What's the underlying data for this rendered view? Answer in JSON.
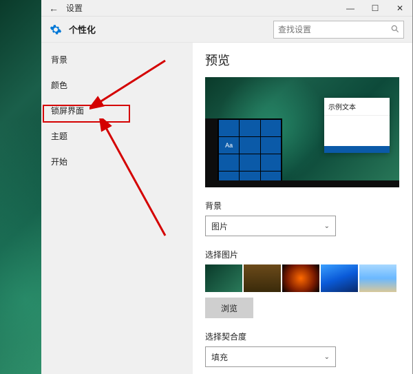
{
  "titlebar": {
    "back": "←",
    "title": "设置",
    "minimize": "—",
    "maximize": "☐",
    "close": "✕"
  },
  "header": {
    "title": "个性化",
    "search_placeholder": "查找设置"
  },
  "sidebar": {
    "items": [
      {
        "label": "背景"
      },
      {
        "label": "颜色"
      },
      {
        "label": "锁屏界面"
      },
      {
        "label": "主题"
      },
      {
        "label": "开始"
      }
    ]
  },
  "content": {
    "preview_title": "预览",
    "sample_text": "示例文本",
    "aa_label": "Aa",
    "bg_label": "背景",
    "bg_value": "图片",
    "choose_pic_label": "选择图片",
    "browse_label": "浏览",
    "fit_label": "选择契合度",
    "fit_value": "填充"
  }
}
